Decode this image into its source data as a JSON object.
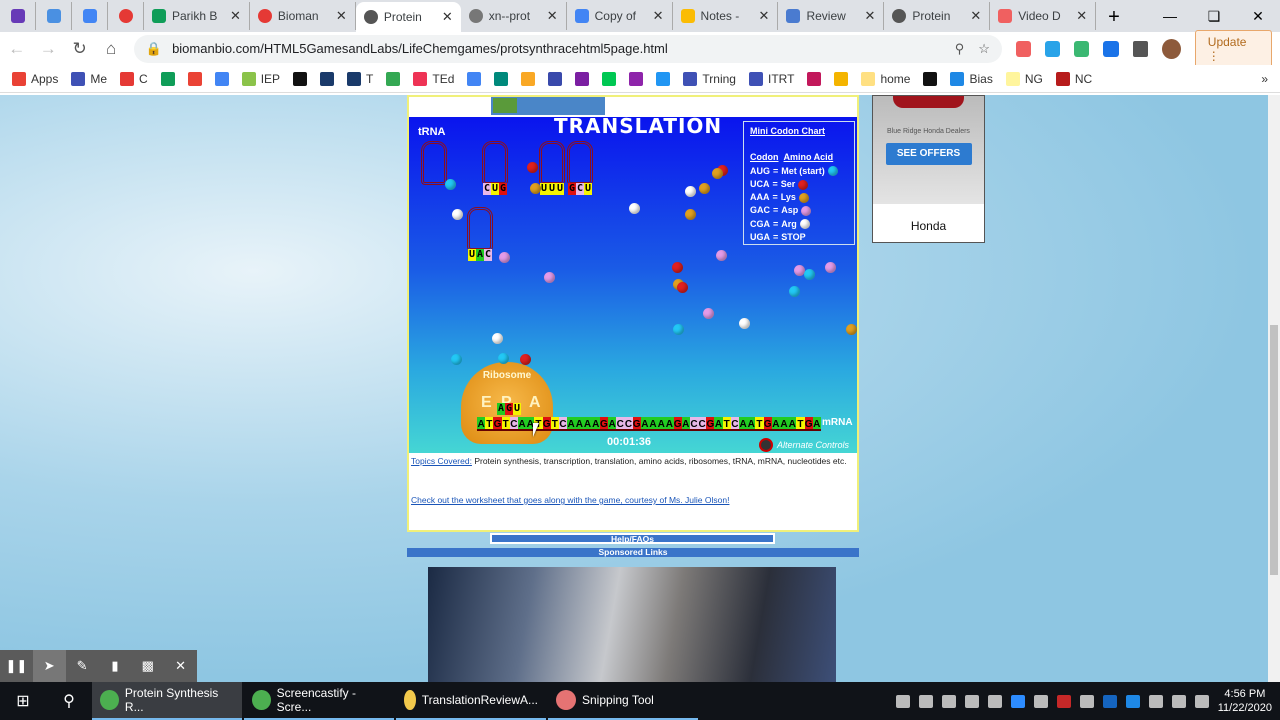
{
  "browser": {
    "tabs": [
      {
        "label": "",
        "pinned": true,
        "icon": "forms-icon",
        "color": "#673ab7"
      },
      {
        "label": "",
        "pinned": true,
        "icon": "pointer-icon",
        "color": "#4a90e2"
      },
      {
        "label": "",
        "pinned": true,
        "icon": "docs-icon",
        "color": "#4285f4"
      },
      {
        "label": "",
        "pinned": true,
        "icon": "ring-icon",
        "color": "#e53935"
      },
      {
        "label": "Parikh B",
        "icon": "sheets-icon",
        "color": "#0f9d58"
      },
      {
        "label": "Bioman",
        "icon": "ring-icon",
        "color": "#e53935"
      },
      {
        "label": "Protein",
        "icon": "globe-icon",
        "color": "#555555",
        "active": true
      },
      {
        "label": "xn--prot",
        "icon": "globe-icon",
        "color": "#777777"
      },
      {
        "label": "Copy of",
        "icon": "docs-icon",
        "color": "#4285f4"
      },
      {
        "label": "Notes -",
        "icon": "drive-icon",
        "color": "#fbbc04"
      },
      {
        "label": "Review",
        "icon": "task-icon",
        "color": "#4a7bd0"
      },
      {
        "label": "Protein",
        "icon": "globe-icon",
        "color": "#555555"
      },
      {
        "label": "Video D",
        "icon": "video-icon",
        "color": "#f06060"
      }
    ],
    "new_tab": "+",
    "url": "biomanbio.com/HTML5GamesandLabs/LifeChemgames/protsynthracehtml5page.html",
    "update_label": "Update",
    "bookmarks": [
      {
        "label": "Apps",
        "color": "#e94235"
      },
      {
        "label": "Me",
        "color": "#3f51b5"
      },
      {
        "label": "C",
        "color": "#e53935"
      },
      {
        "label": "",
        "color": "#0f9d58"
      },
      {
        "label": "",
        "color": "#ea4335"
      },
      {
        "label": "",
        "color": "#4285f4"
      },
      {
        "label": "IEP",
        "color": "#8bc34a"
      },
      {
        "label": "",
        "color": "#111111"
      },
      {
        "label": "",
        "color": "#1a3a6a"
      },
      {
        "label": "T",
        "color": "#1a3a6a"
      },
      {
        "label": "",
        "color": "#34a853"
      },
      {
        "label": "TEd",
        "color": "#e35"
      },
      {
        "label": "",
        "color": "#4285f4"
      },
      {
        "label": "",
        "color": "#00897b"
      },
      {
        "label": "",
        "color": "#f9a825"
      },
      {
        "label": "",
        "color": "#3949ab"
      },
      {
        "label": "",
        "color": "#7b1fa2"
      },
      {
        "label": "",
        "color": "#00c853"
      },
      {
        "label": "",
        "color": "#8e24aa"
      },
      {
        "label": "",
        "color": "#2196f3"
      },
      {
        "label": "Trning",
        "color": "#3f51b5"
      },
      {
        "label": "ITRT",
        "color": "#3f51b5"
      },
      {
        "label": "",
        "color": "#c2185b"
      },
      {
        "label": "",
        "color": "#f4b400"
      },
      {
        "label": "home",
        "color": "#ffe082"
      },
      {
        "label": "",
        "color": "#111111"
      },
      {
        "label": "Bias",
        "color": "#1e88e5"
      },
      {
        "label": "NG",
        "color": "#fff59d"
      },
      {
        "label": "NC",
        "color": "#b71c1c"
      }
    ],
    "more_bookmarks": "»"
  },
  "game": {
    "title": "TRANSLATION",
    "trna_label": "tRNA",
    "codon_chart": {
      "title": "Mini Codon Chart",
      "col_codon": "Codon",
      "col_amino": "Amino Acid",
      "rows": [
        {
          "codon": "AUG",
          "amino": "Met (start)",
          "color": "#22c8f5"
        },
        {
          "codon": "UCA",
          "amino": "Ser",
          "color": "#e02020"
        },
        {
          "codon": "AAA",
          "amino": "Lys",
          "color": "#e0a020"
        },
        {
          "codon": "GAC",
          "amino": "Asp",
          "color": "#e49be8"
        },
        {
          "codon": "CGA",
          "amino": "Arg",
          "color": "#ffffff"
        },
        {
          "codon": "UGA",
          "amino": "STOP",
          "color": ""
        }
      ]
    },
    "trna_anticodons": [
      "CUG",
      "UUU",
      "GCU",
      "UAC"
    ],
    "ribosome_label": "Ribosome",
    "sites": [
      "E",
      "P",
      "A"
    ],
    "p_site_anticodon": "AGU",
    "mrna_sequence": "ATGTCAATGTCAAAAGACCGAAAAGACCGATCAATGAAATGA",
    "base_colors": {
      "A": "#22cc22",
      "T": "#f5f500",
      "G": "#e01010",
      "C": "#e8b8e8"
    },
    "mrna_label": "mRNA",
    "timer": "00:01:36",
    "alternate_controls": "Alternate Controls"
  },
  "info": {
    "topics_label": "Topics Covered:",
    "topics_text": "Protein synthesis, transcription, translation, amino acids, ribosomes, tRNA, mRNA, nucleotides etc.",
    "worksheet_link": "Check out the worksheet that goes along with the game, courtesy of Ms. Julie Olson!",
    "help": "Help/FAQs",
    "sponsored": "Sponsored Links"
  },
  "ad": {
    "dealer": "Blue Ridge Honda Dealers",
    "cta": "SEE OFFERS",
    "brand": "Honda"
  },
  "screencastify": [
    "pause",
    "cursor",
    "pen",
    "highlighter",
    "camera",
    "close"
  ],
  "taskbar": {
    "apps": [
      {
        "label": "Protein Synthesis R...",
        "color": "#4caf50",
        "active": true
      },
      {
        "label": "Screencastify - Scre...",
        "color": "#4caf50"
      },
      {
        "label": "TranslationReviewA...",
        "color": "#f2c94c"
      },
      {
        "label": "Snipping Tool",
        "color": "#e57373"
      }
    ],
    "time": "4:56 PM",
    "date": "11/22/2020"
  }
}
